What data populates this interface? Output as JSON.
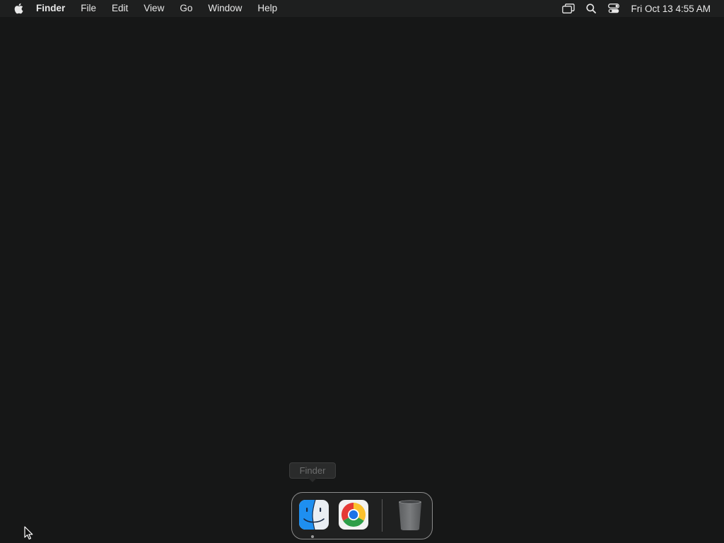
{
  "menubar": {
    "apple_icon": "apple-logo-icon",
    "app_name": "Finder",
    "items": [
      "File",
      "Edit",
      "View",
      "Go",
      "Window",
      "Help"
    ],
    "status_icons": [
      "screen-mirroring-icon",
      "spotlight-search-icon",
      "control-center-icon"
    ],
    "clock": "Fri Oct 13  4:55 AM"
  },
  "tooltip": {
    "label": "Finder"
  },
  "dock": {
    "apps": [
      {
        "name": "Finder",
        "icon": "finder-icon",
        "running": true
      },
      {
        "name": "Google Chrome",
        "icon": "chrome-icon",
        "running": false
      }
    ],
    "trash": {
      "name": "Trash",
      "icon": "trash-icon"
    }
  },
  "colors": {
    "desktop_background": "#161717",
    "menubar_background": "#1e1f1f",
    "menubar_text": "#e8e8e8"
  }
}
